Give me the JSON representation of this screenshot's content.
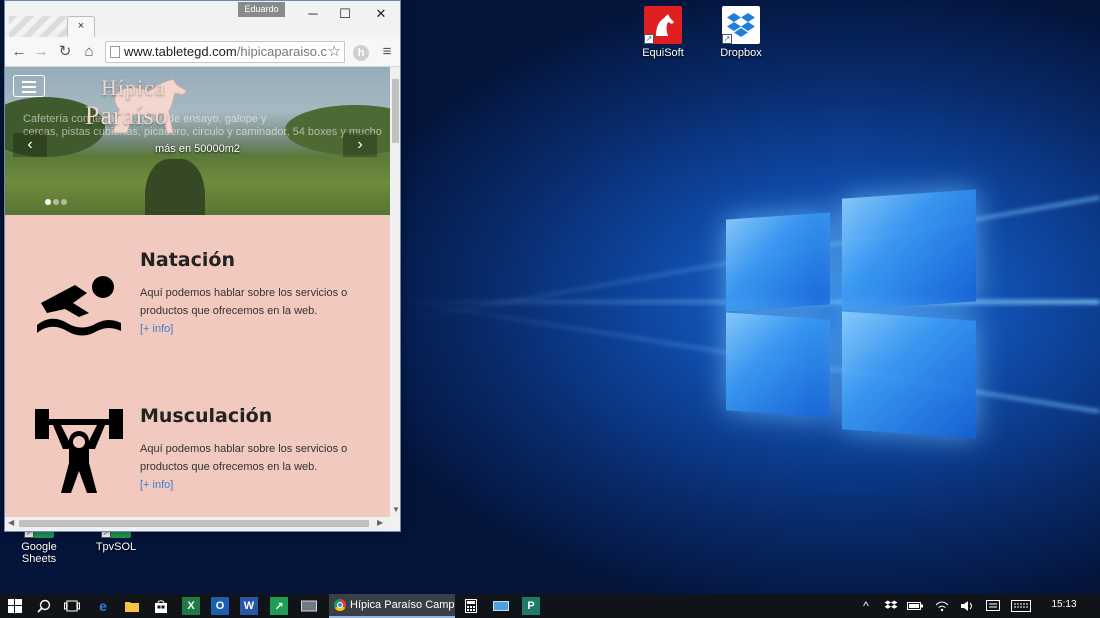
{
  "desktop": {
    "icons": [
      {
        "label": "EquiSoft",
        "icon": "horse-app-icon",
        "color": "#e02020"
      },
      {
        "label": "Dropbox",
        "icon": "dropbox-icon",
        "color": "#ffffff"
      },
      {
        "label": "Google Sheets",
        "icon": "google-sheets-icon",
        "color": "#1f9d55"
      },
      {
        "label": "TpvSOL",
        "icon": "tpvsol-icon",
        "color": "#1f9d55"
      }
    ]
  },
  "browser": {
    "user": "Eduardo",
    "tab_close": "×",
    "url_host": "www.tabletegd.com",
    "url_path": "/hipicaparaiso.c",
    "extension_letter": "h",
    "hero": {
      "logo_line1": "Hípica",
      "logo_line2": "Paraíso",
      "desc_line1": "Cafetería con terraza ... pista de ensayo, galope y",
      "desc_line2": "cercas, pistas cubiertas, picadero, circulo y caminador, 54 boxes y mucho",
      "desc_line3": "más en 50000m2",
      "prev": "‹",
      "next": "›"
    },
    "services": [
      {
        "title": "Natación",
        "desc": "Aquí podemos hablar sobre los servicios o productos que ofrecemos en la web.",
        "link": "[+ info]",
        "icon": "swimmer-icon"
      },
      {
        "title": "Musculación",
        "desc": "Aquí podemos hablar sobre los servicios o productos que ofrecemos en la web.",
        "link": "[+ info]",
        "icon": "weightlifter-icon"
      }
    ]
  },
  "taskbar": {
    "active_task": "Hípica Paraíso Camp...",
    "time": "15:13",
    "accent": "#8fb6e6"
  }
}
